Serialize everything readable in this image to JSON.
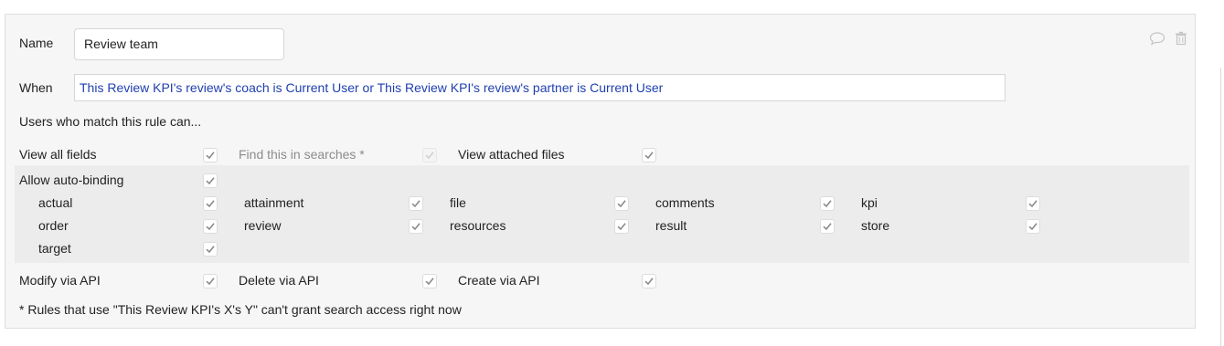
{
  "rule": {
    "name_label": "Name",
    "name_value": "Review team",
    "when_label": "When",
    "when_value": "This Review KPI's review's coach is Current User or This Review KPI's review's partner is Current User",
    "users_intro": "Users who match this rule can...",
    "footnote": "* Rules that use \"This Review KPI's X's Y\" can't grant search access right now"
  },
  "permissions": {
    "view_all_fields": {
      "label": "View all fields",
      "checked": true
    },
    "find_in_searches": {
      "label": "Find this in searches *",
      "checked": true,
      "disabled": true
    },
    "view_attached_files": {
      "label": "View attached files",
      "checked": true
    },
    "allow_auto_binding": {
      "label": "Allow auto-binding",
      "checked": true
    },
    "modify_via_api": {
      "label": "Modify via API",
      "checked": true
    },
    "delete_via_api": {
      "label": "Delete via API",
      "checked": true
    },
    "create_via_api": {
      "label": "Create via API",
      "checked": true
    }
  },
  "binding_fields": [
    {
      "label": "actual",
      "checked": true
    },
    {
      "label": "attainment",
      "checked": true
    },
    {
      "label": "file",
      "checked": true
    },
    {
      "label": "comments",
      "checked": true
    },
    {
      "label": "kpi",
      "checked": true
    },
    {
      "label": "order",
      "checked": true
    },
    {
      "label": "review",
      "checked": true
    },
    {
      "label": "resources",
      "checked": true
    },
    {
      "label": "result",
      "checked": true
    },
    {
      "label": "store",
      "checked": true
    },
    {
      "label": "target",
      "checked": true
    }
  ],
  "icons": {
    "comment": "speech-bubble-icon",
    "delete": "trash-icon"
  },
  "colors": {
    "condition_text": "#1f3fb0",
    "check_mark": "#8a8a8a",
    "muted_text": "#8c8c8c"
  }
}
